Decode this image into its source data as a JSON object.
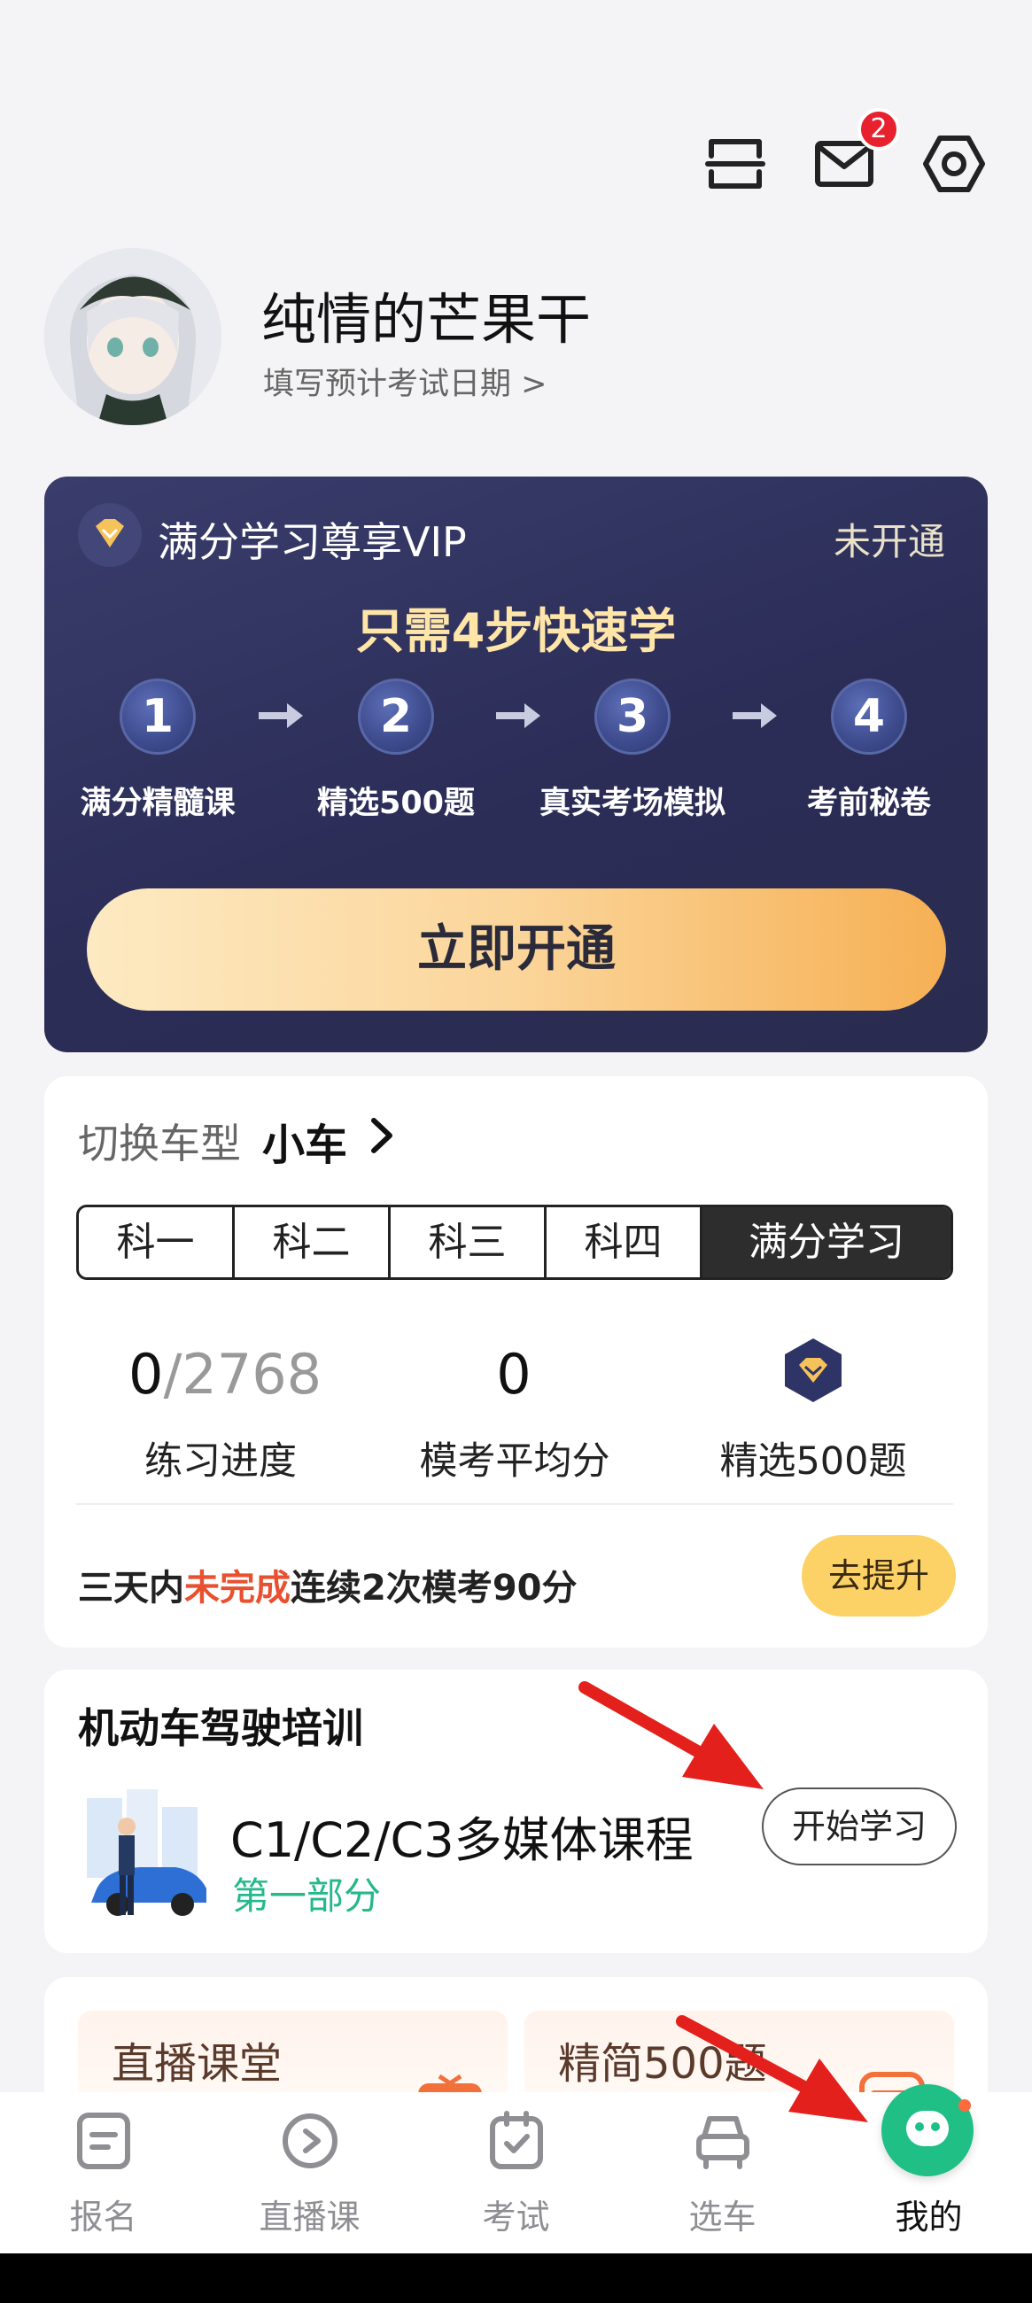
{
  "header": {
    "icons": [
      "scan-icon",
      "mail-icon",
      "settings-icon"
    ],
    "mail_badge": "2"
  },
  "profile": {
    "username": "纯情的芒果干",
    "exam_date_prompt": "填写预计考试日期 >"
  },
  "vip": {
    "title": "满分学习尊享VIP",
    "status": "未开通",
    "steps_title": "只需4步快速学",
    "steps": [
      {
        "num": "1",
        "label": "满分精髓课"
      },
      {
        "num": "2",
        "label": "精选500题"
      },
      {
        "num": "3",
        "label": "真实考场模拟"
      },
      {
        "num": "4",
        "label": "考前秘卷"
      }
    ],
    "cta": "立即开通",
    "colors": {
      "card": "#2b2d57",
      "accent": "#ffe6a8",
      "cta_end": "#f6b054"
    }
  },
  "study": {
    "switch_label": "切换车型",
    "vehicle": "小车",
    "tabs": [
      "科一",
      "科二",
      "科三",
      "科四",
      "满分学习"
    ],
    "active_tab": "满分学习",
    "progress_done": "0",
    "progress_total": "/2768",
    "progress_label": "练习进度",
    "mock_avg": "0",
    "mock_avg_label": "模考平均分",
    "selected_label": "精选500题",
    "challenge_pre": "三天内",
    "challenge_red": "未完成",
    "challenge_post": "连续2次模考90分",
    "improve_btn": "去提升"
  },
  "training": {
    "title": "机动车驾驶培训",
    "course_title": "C1/C2/C3多媒体课程",
    "course_sub": "第一部分",
    "start_btn": "开始学习"
  },
  "peek": {
    "live_title": "直播课堂",
    "simple_title": "精简500题"
  },
  "tabbar": {
    "items": [
      {
        "label": "报名",
        "icon": "signup-icon"
      },
      {
        "label": "直播课",
        "icon": "live-icon"
      },
      {
        "label": "考试",
        "icon": "exam-icon"
      },
      {
        "label": "选车",
        "icon": "car-icon"
      },
      {
        "label": "我的",
        "icon": "mine-icon"
      }
    ],
    "active": "我的",
    "accent": "#1fbf86"
  }
}
